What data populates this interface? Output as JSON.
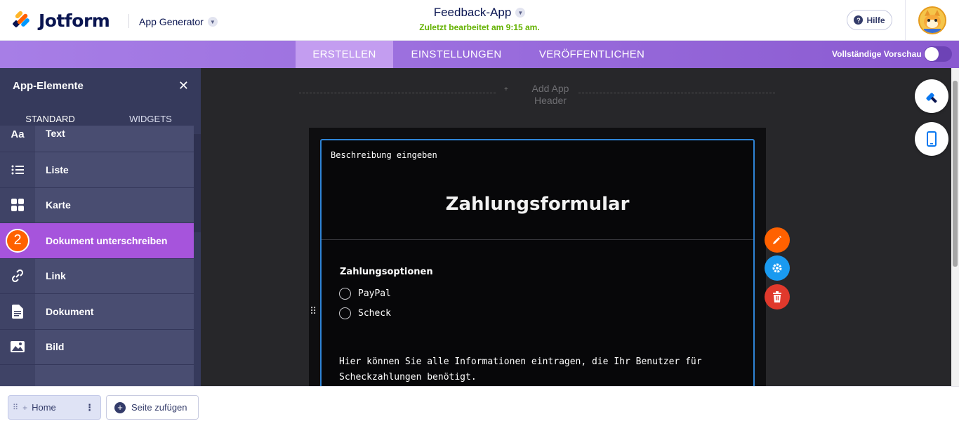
{
  "header": {
    "logo_text": "Jotform",
    "app_generator_label": "App Generator",
    "app_title": "Feedback-App",
    "last_edited": "Zuletzt bearbeitet am 9:15 am.",
    "help_label": "Hilfe"
  },
  "tabs": [
    {
      "label": "ERSTELLEN",
      "active": true
    },
    {
      "label": "EINSTELLUNGEN",
      "active": false
    },
    {
      "label": "VERÖFFENTLICHEN",
      "active": false
    }
  ],
  "preview": {
    "label": "Vollständige Vorschau",
    "enabled": false
  },
  "sidebar": {
    "title": "App-Elemente",
    "tabs": [
      {
        "label": "STANDARD",
        "active": true
      },
      {
        "label": "WIDGETS",
        "active": false
      }
    ],
    "items": [
      {
        "label": "Text",
        "icon": "text-icon",
        "glyph": "Aa"
      },
      {
        "label": "Liste",
        "icon": "list-icon",
        "glyph": "☰"
      },
      {
        "label": "Karte",
        "icon": "card-icon",
        "glyph": "▚"
      },
      {
        "label": "Dokument unterschreiben",
        "icon": "sign-document-icon",
        "glyph": "2",
        "selected": true
      },
      {
        "label": "Link",
        "icon": "link-icon",
        "glyph": "🔗"
      },
      {
        "label": "Dokument",
        "icon": "document-icon",
        "glyph": "▤"
      },
      {
        "label": "Bild",
        "icon": "image-icon",
        "glyph": "▨"
      }
    ],
    "step_badge": "2"
  },
  "canvas": {
    "add_header_label": "Add App Header",
    "description": "Beschreibung eingeben",
    "form_title": "Zahlungsformular",
    "payment_label": "Zahlungsoptionen",
    "payment_options": [
      "PayPal",
      "Scheck"
    ],
    "info_text": "Hier können Sie alle Informationen eintragen, die Ihr Benutzer für Scheckzahlungen benötigt."
  },
  "bottom": {
    "home_page": "Home",
    "add_page": "Seite zufügen"
  },
  "colors": {
    "accent_purple": "#a654dc",
    "step_badge": "#ff6100",
    "edit_button": "#ff6100",
    "settings_button": "#1a9af0",
    "delete_button": "#e0392c"
  }
}
